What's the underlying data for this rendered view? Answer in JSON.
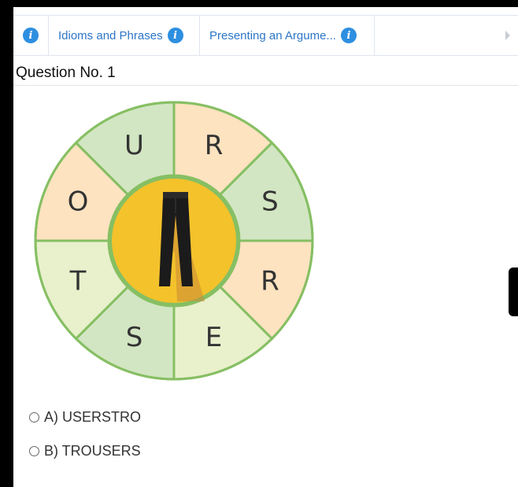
{
  "tabs": [
    {
      "label": "",
      "info_icon": "info-icon"
    },
    {
      "label": "Idioms and Phrases",
      "info_icon": "info-icon"
    },
    {
      "label": "Presenting an Argume...",
      "info_icon": "info-icon"
    }
  ],
  "question": {
    "title": "Question No. 1"
  },
  "wheel": {
    "letters": [
      "U",
      "R",
      "S",
      "R",
      "E",
      "S",
      "T",
      "O"
    ],
    "colors": {
      "peach": "#fde3c0",
      "green": "#d2e6c3",
      "pale": "#e9f0cc",
      "border": "#86bf63",
      "hub": "#f4c22b"
    },
    "center_icon": "trousers-icon"
  },
  "options": [
    {
      "label": "A) USERSTRO"
    },
    {
      "label": "B) TROUSERS"
    }
  ],
  "colors": {
    "tab_text": "#2d76c7",
    "info_blue": "#2d8fe0"
  }
}
